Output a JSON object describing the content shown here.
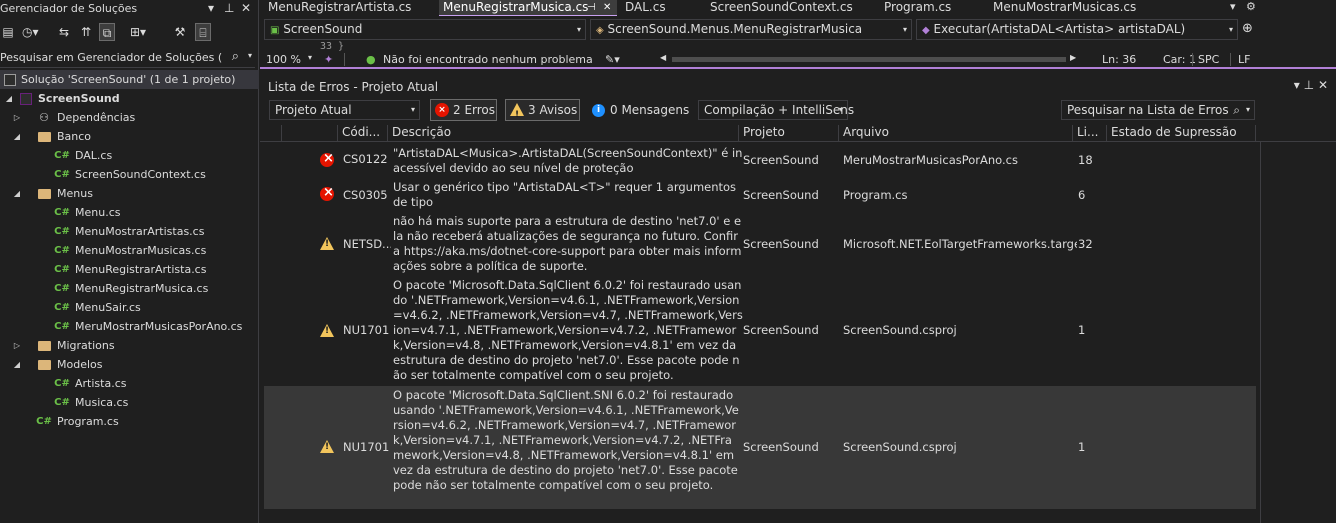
{
  "solution_explorer": {
    "title": "Gerenciador de Soluções",
    "search_placeholder": "Pesquisar em Gerenciador de Soluções (Ctr",
    "items": [
      {
        "label": "Solução 'ScreenSound' (1 de 1 projeto)",
        "kind": "solution"
      },
      {
        "label": "ScreenSound",
        "kind": "project"
      },
      {
        "label": "Dependências",
        "kind": "dependencies"
      },
      {
        "label": "Banco",
        "kind": "folder"
      },
      {
        "label": "DAL.cs",
        "kind": "csharp-file"
      },
      {
        "label": "ScreenSoundContext.cs",
        "kind": "csharp-file"
      },
      {
        "label": "Menus",
        "kind": "folder"
      },
      {
        "label": "Menu.cs",
        "kind": "csharp-file"
      },
      {
        "label": "MenuMostrarArtistas.cs",
        "kind": "csharp-file"
      },
      {
        "label": "MenuMostrarMusicas.cs",
        "kind": "csharp-file"
      },
      {
        "label": "MenuRegistrarArtista.cs",
        "kind": "csharp-file"
      },
      {
        "label": "MenuRegistrarMusica.cs",
        "kind": "csharp-file"
      },
      {
        "label": "MenuSair.cs",
        "kind": "csharp-file"
      },
      {
        "label": "MeruMostrarMusicasPorAno.cs",
        "kind": "csharp-file"
      },
      {
        "label": "Migrations",
        "kind": "folder"
      },
      {
        "label": "Modelos",
        "kind": "folder"
      },
      {
        "label": "Artista.cs",
        "kind": "csharp-file"
      },
      {
        "label": "Musica.cs",
        "kind": "csharp-file"
      },
      {
        "label": "Program.cs",
        "kind": "csharp-file"
      }
    ],
    "csharp_icon_text": "C#"
  },
  "editor": {
    "tabs": [
      {
        "label": "MenuRegistrarArtista.cs"
      },
      {
        "label": "MenuRegistrarMusica.cs",
        "active": true
      },
      {
        "label": "DAL.cs"
      },
      {
        "label": "ScreenSoundContext.cs"
      },
      {
        "label": "Program.cs"
      },
      {
        "label": "MenuMostrarMusicas.cs"
      }
    ],
    "nav": {
      "project": "ScreenSound",
      "type": "ScreenSound.Menus.MenuRegistrarMusica",
      "member": "Executar(ArtistaDAL<Artista> artistaDAL)"
    },
    "code_peek": "33          }",
    "status": {
      "zoom": "100 %",
      "message": "Não foi encontrado nenhum problema",
      "line": "Ln: 36",
      "char": "Car: 1",
      "whitespace": "SPC",
      "line_ending": "LF"
    }
  },
  "error_list": {
    "title": "Lista de Erros - Projeto Atual",
    "scope": "Projeto Atual",
    "errors_filter": "2 Erros",
    "warnings_filter": "3 Avisos",
    "messages_filter": "0 Mensagens",
    "build_filter": "Compilação + IntelliSens",
    "search_placeholder": "Pesquisar na Lista de Erros",
    "columns": {
      "code": "Códi...",
      "description": "Descrição",
      "project": "Projeto",
      "file": "Arquivo",
      "line": "Li...",
      "suppression": "Estado de Supressão"
    },
    "rows": [
      {
        "severity": "error",
        "code": "CS0122",
        "description": "\"ArtistaDAL<Musica>.ArtistaDAL(ScreenSoundContext)\" é inacessível devido ao seu nível de proteção",
        "project": "ScreenSound",
        "file": "MeruMostrarMusicasPorAno.cs",
        "line": "18"
      },
      {
        "severity": "error",
        "code": "CS0305",
        "description": "Usar o genérico tipo \"ArtistaDAL<T>\" requer 1 argumentos de tipo",
        "project": "ScreenSound",
        "file": "Program.cs",
        "line": "6"
      },
      {
        "severity": "warning",
        "code": "NETSD...",
        "description": "não há mais suporte para a estrutura de destino 'net7.0' e ela não receberá atualizações de segurança no futuro. Confira https://aka.ms/dotnet-core-support para obter mais informações sobre a política de suporte.",
        "project": "ScreenSound",
        "file": "Microsoft.NET.EolTargetFrameworks.targets",
        "line": "32"
      },
      {
        "severity": "warning",
        "code": "NU1701",
        "description": "O pacote 'Microsoft.Data.SqlClient 6.0.2' foi restaurado usando '.NETFramework,Version=v4.6.1, .NETFramework,Version=v4.6.2, .NETFramework,Version=v4.7, .NETFramework,Version=v4.7.1, .NETFramework,Version=v4.7.2, .NETFramework,Version=v4.8, .NETFramework,Version=v4.8.1' em vez da estrutura de destino do projeto 'net7.0'. Esse pacote pode não ser totalmente compatível com o seu projeto.",
        "project": "ScreenSound",
        "file": "ScreenSound.csproj",
        "line": "1"
      },
      {
        "severity": "warning",
        "code": "NU1701",
        "description": "O pacote 'Microsoft.Data.SqlClient.SNI 6.0.2' foi restaurado usando '.NETFramework,Version=v4.6.1, .NETFramework,Version=v4.6.2, .NETFramework,Version=v4.7, .NETFramework,Version=v4.7.1, .NETFramework,Version=v4.7.2, .NETFramework,Version=v4.8, .NETFramework,Version=v4.8.1' em vez da estrutura de destino do projeto 'net7.0'. Esse pacote pode não ser totalmente compatível com o seu projeto.",
        "project": "ScreenSound",
        "file": "ScreenSound.csproj",
        "line": "1",
        "selected": true
      }
    ]
  },
  "colors": {
    "background": "#1f1f1f",
    "accent": "#b180d7",
    "error": "#e51400",
    "warning": "#f2c55c",
    "info": "#1e90ff",
    "folder": "#dcb67a",
    "csharp": "#6bc048"
  }
}
